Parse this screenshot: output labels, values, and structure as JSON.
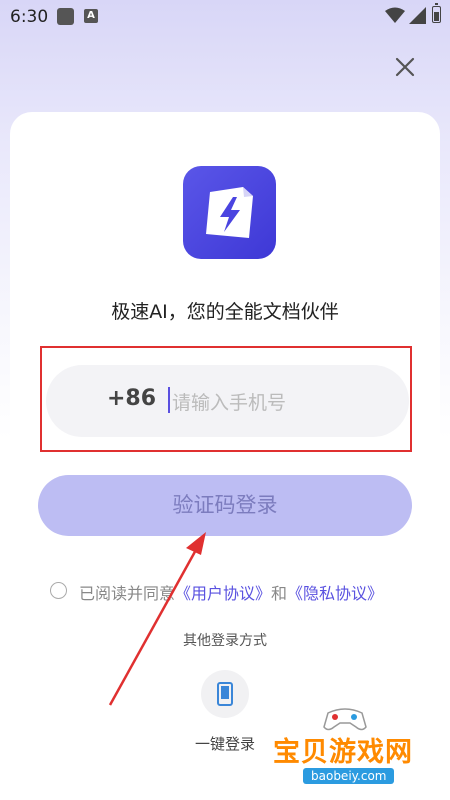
{
  "status_bar": {
    "time": "6:30",
    "badge": "A"
  },
  "header": {
    "close_icon": "close-icon"
  },
  "brand": {
    "logo_icon": "lightning-document-icon",
    "tagline": "极速AI，您的全能文档伙伴",
    "accent": "#4a44e0"
  },
  "phone_input": {
    "country_code": "+86",
    "placeholder": "请输入手机号"
  },
  "login_button": {
    "label": "验证码登录",
    "bg_color": "#bdbdf3"
  },
  "agreement": {
    "prefix": "已阅读并同意",
    "user_agreement": "《用户协议》",
    "conjunction": "和",
    "privacy_policy": "《隐私协议》"
  },
  "other_login": {
    "title": "其他登录方式",
    "one_key_label": "一键登录",
    "one_key_icon": "phone-icon"
  },
  "watermark": {
    "title": "宝贝游戏网",
    "url": "baobeiy.com"
  }
}
